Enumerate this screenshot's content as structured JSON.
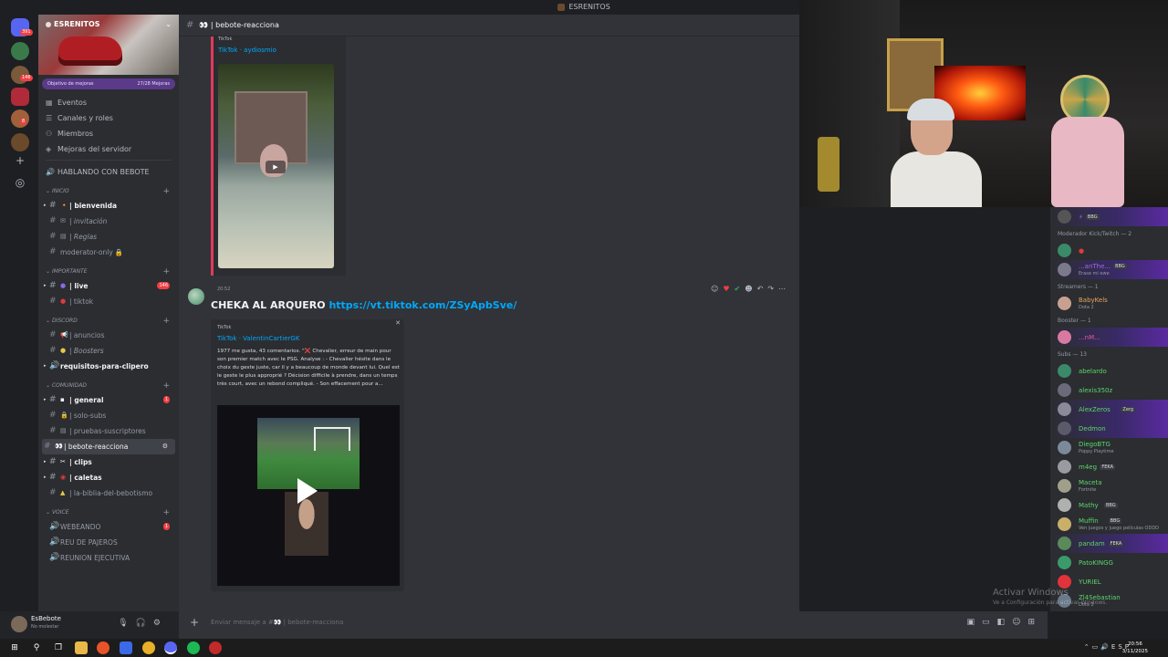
{
  "window": {
    "title": "ESRENITOS"
  },
  "rail": {
    "badges": [
      "391",
      "146",
      "8",
      "8"
    ]
  },
  "server": {
    "name": "ESRENITOS",
    "boost_goal": "Objetivo de mejoras",
    "boost_count": "27/28 Mejoras"
  },
  "menu": {
    "events": "Eventos",
    "channels_roles": "Canales y roles",
    "members": "Miembros",
    "server_boosts": "Mejoras del servidor",
    "talking": "HABLANDO CON BEBOTE"
  },
  "categories": {
    "inicio": "INICIO",
    "importante": "IMPORTANTE",
    "discord": "DISCORD",
    "comunidad": "COMUNIDAD",
    "voice": "VOICE"
  },
  "channels": {
    "bienvenida": "| bienvenida",
    "invitacion": "| invitación",
    "reglas": "| Reglas",
    "moderator_only": "moderator-only",
    "live": "| live",
    "live_count": "146",
    "tiktok": "| tiktok",
    "anuncios": "| anuncios",
    "boosters": "| Boosters",
    "requisitos": "requisitos-para-clipero",
    "general": "| general",
    "general_count": "1",
    "solo_subs": "| solo-subs",
    "pruebas": "| pruebas-suscriptores",
    "bebote": "| bebote-reacciona",
    "clips": "| clips",
    "caletas": "| caletas",
    "biblia": "| la-biblia-del-bebotismo",
    "webeando": "WEBEANDO",
    "webeando_count": "1",
    "reu": "REU DE PAJEROS",
    "reunion": "REUNION EJECUTIVA"
  },
  "user": {
    "name": "EsBebote",
    "status": "No molestar"
  },
  "header": {
    "channel": "| bebote-reacciona"
  },
  "embed1": {
    "provider": "TikTok",
    "author": "TikTok · aydiosmio"
  },
  "message": {
    "time": "20:52",
    "text": "CHEKA AL ARQUERO ",
    "link": "https://vt.tiktok.com/ZSyApbSve/"
  },
  "embed2": {
    "provider": "TikTok",
    "author": "TikTok · ValentinCartierGK",
    "description": "1977 me gusta, 43 comentarios. \"❌ Chevalier, erreur de main pour son premier match avec le PSG. Analyse : - Chevalier hésite dans le choix du geste juste, car il y a beaucoup de monde devant lui. Quel est le geste le plus approprié ? Décision difficile à prendre, dans un temps très court, avec un rebond compliqué. - Son effacement pour a..."
  },
  "composer": {
    "placeholder": "Enviar mensaje a #👀 | bebote-reacciona"
  },
  "members": {
    "top_tag": "BBG",
    "cat_mods": "Moderador Kick/Twitch — 2",
    "mod2_name": "...anThe...",
    "mod2_tag": "BBG",
    "mod2_sub": "Erase mi ewe",
    "cat_streamers": "Streamers — 1",
    "streamer_name": "BabyKels",
    "streamer_sub": "Dota 2",
    "cat_booster": "Booster — 1",
    "booster_name": "...nM...",
    "cat_subs": "Subs — 13",
    "subs": [
      {
        "name": "abelardo",
        "sub": "",
        "tag": ""
      },
      {
        "name": "alexis350z",
        "sub": "",
        "tag": ""
      },
      {
        "name": "AlexZeros",
        "sub": "",
        "tag": "Zerg"
      },
      {
        "name": "Dedmon",
        "sub": "",
        "tag": ""
      },
      {
        "name": "DiegoBTG",
        "sub": "Poppy Playtime",
        "tag": ""
      },
      {
        "name": "m4eg",
        "sub": "",
        "tag": "FEKA"
      },
      {
        "name": "Maceta",
        "sub": "Fortnite",
        "tag": ""
      },
      {
        "name": "Mathy",
        "sub": "",
        "tag": "BBG"
      },
      {
        "name": "Muffin",
        "sub": "Ven juegos y juego películas ODDD",
        "tag": "BBG"
      },
      {
        "name": "pandam",
        "sub": "",
        "tag": "FEKA"
      },
      {
        "name": "PatoKINGG",
        "sub": "",
        "tag": ""
      },
      {
        "name": "YURIEL",
        "sub": "",
        "tag": ""
      },
      {
        "name": "Zl4Sebastian",
        "sub": "Dota 2",
        "tag": ""
      }
    ]
  },
  "watermark": {
    "title": "Activar Windows",
    "sub": "Ve a Configuración para activar Windows."
  },
  "taskbar": {
    "lang": "ESP",
    "time": "20:56",
    "date": "3/11/2025"
  },
  "colors": {
    "accent": "#5865f2",
    "link": "#00a8fc",
    "embed_border": "#e23a5c",
    "sub_green": "#5cd66a"
  }
}
